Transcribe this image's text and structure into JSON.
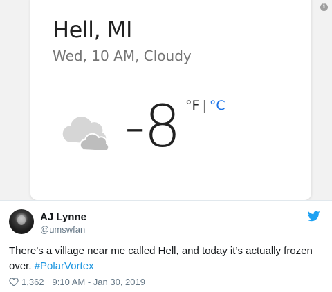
{
  "weather": {
    "location": "Hell, MI",
    "conditions": "Wed, 10 AM, Cloudy",
    "temperature": "-8",
    "unit_f": "°F",
    "unit_separator": "|",
    "unit_c": "°C",
    "condition_icon": "cloud-icon"
  },
  "tweet": {
    "display_name": "AJ Lynne",
    "handle": "@umswfan",
    "text_main": "There’s a village near me called Hell, and today it’s actually frozen over. ",
    "hashtag": "#PolarVortex",
    "likes": "1,362",
    "timestamp": "9:10 AM - Jan 30, 2019",
    "icons": [
      "info-icon",
      "twitter-bird-icon",
      "heart-icon"
    ]
  },
  "colors": {
    "twitter_blue": "#1da1f2",
    "link_blue": "#1b95e0",
    "celsius_blue": "#1a73e8"
  }
}
